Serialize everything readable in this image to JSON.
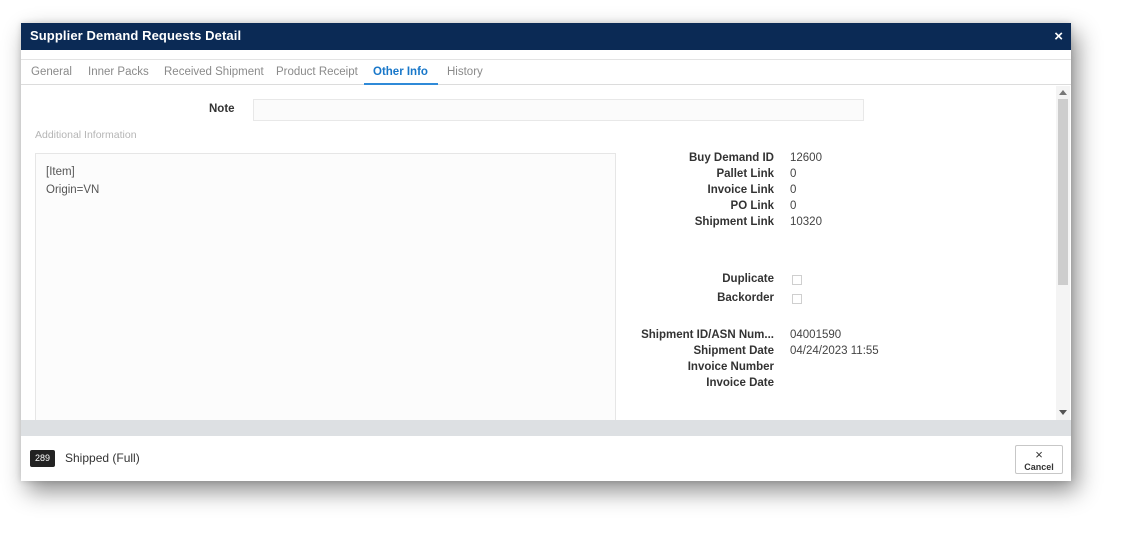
{
  "dialog": {
    "title": "Supplier Demand Requests Detail",
    "close_glyph": "×"
  },
  "tabs": [
    {
      "label": "General",
      "active": false
    },
    {
      "label": "Inner Packs",
      "active": false
    },
    {
      "label": "Received Shipment",
      "active": false
    },
    {
      "label": "Product Receipt",
      "active": false
    },
    {
      "label": "Other Info",
      "active": true
    },
    {
      "label": "History",
      "active": false
    }
  ],
  "note": {
    "label": "Note",
    "value": ""
  },
  "additional_info": {
    "label": "Additional Information",
    "lines": [
      "[Item]",
      "Origin=VN"
    ]
  },
  "fields": {
    "buy_demand_id": {
      "label": "Buy Demand ID",
      "value": "12600"
    },
    "pallet_link": {
      "label": "Pallet Link",
      "value": "0"
    },
    "invoice_link": {
      "label": "Invoice Link",
      "value": "0"
    },
    "po_link": {
      "label": "PO Link",
      "value": "0"
    },
    "shipment_link": {
      "label": "Shipment Link",
      "value": "10320"
    },
    "duplicate": {
      "label": "Duplicate",
      "checked": false
    },
    "backorder": {
      "label": "Backorder",
      "checked": false
    },
    "shipment_id": {
      "label": "Shipment ID/ASN Num...",
      "value": "04001590"
    },
    "shipment_date": {
      "label": "Shipment Date",
      "value": "04/24/2023 11:55"
    },
    "invoice_number": {
      "label": "Invoice Number",
      "value": ""
    },
    "invoice_date": {
      "label": "Invoice Date",
      "value": ""
    }
  },
  "footer": {
    "badge": "289",
    "status": "Shipped (Full)",
    "cancel_glyph": "×",
    "cancel_label": "Cancel"
  },
  "colors": {
    "titlebar": "#0b2a55",
    "active_tab": "#1877c9",
    "badge_bg": "#222222"
  }
}
